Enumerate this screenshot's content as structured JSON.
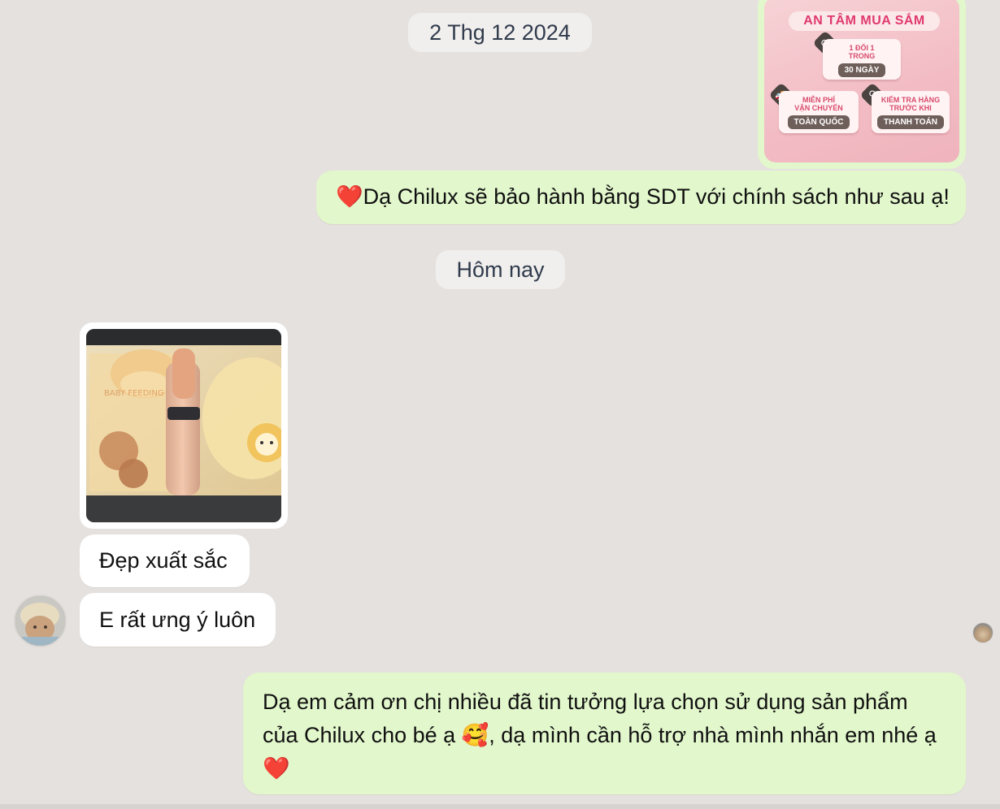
{
  "chat": {
    "date_separator_1": "2 Thg 12 2024",
    "date_separator_2": "Hôm nay",
    "promo_card": {
      "title": "AN TÂM MUA SẮM",
      "exchange_top": "1 ĐỔI 1",
      "exchange_mid": "TRONG",
      "exchange_tag": "30 NGÀY",
      "shipping_top": "MIỄN PHÍ",
      "shipping_mid": "VẬN CHUYỂN",
      "shipping_tag": "TOÀN QUỐC",
      "inspect_top": "KIỂM TRA HÀNG",
      "inspect_mid": "TRƯỚC KHI",
      "inspect_tag": "THANH TOÁN"
    },
    "outgoing_1": {
      "emoji": "❤️",
      "text": "Dạ Chilux sẽ bảo hành bằng SDT với chính sách như sau ạ!"
    },
    "incoming_1": "Đẹp xuất sắc",
    "incoming_2": "E rất ưng ý luôn",
    "outgoing_2": {
      "line1": "Dạ em cảm ơn chị nhiều đã tin tưởng lựa chọn sử dụng sản phẩm",
      "line2_a": "của Chilux cho bé ạ ",
      "line2_emoji": "🥰",
      "line2_b": ", dạ mình cần hỗ trợ nhà mình nhắn em nhé ạ",
      "line3_emoji": "❤️"
    }
  },
  "colors": {
    "background": "#e5e1de",
    "outgoing_bubble": "#e2f7cc",
    "incoming_bubble": "#ffffff",
    "date_pill": "#f1efed",
    "heart": "#e0243a"
  }
}
